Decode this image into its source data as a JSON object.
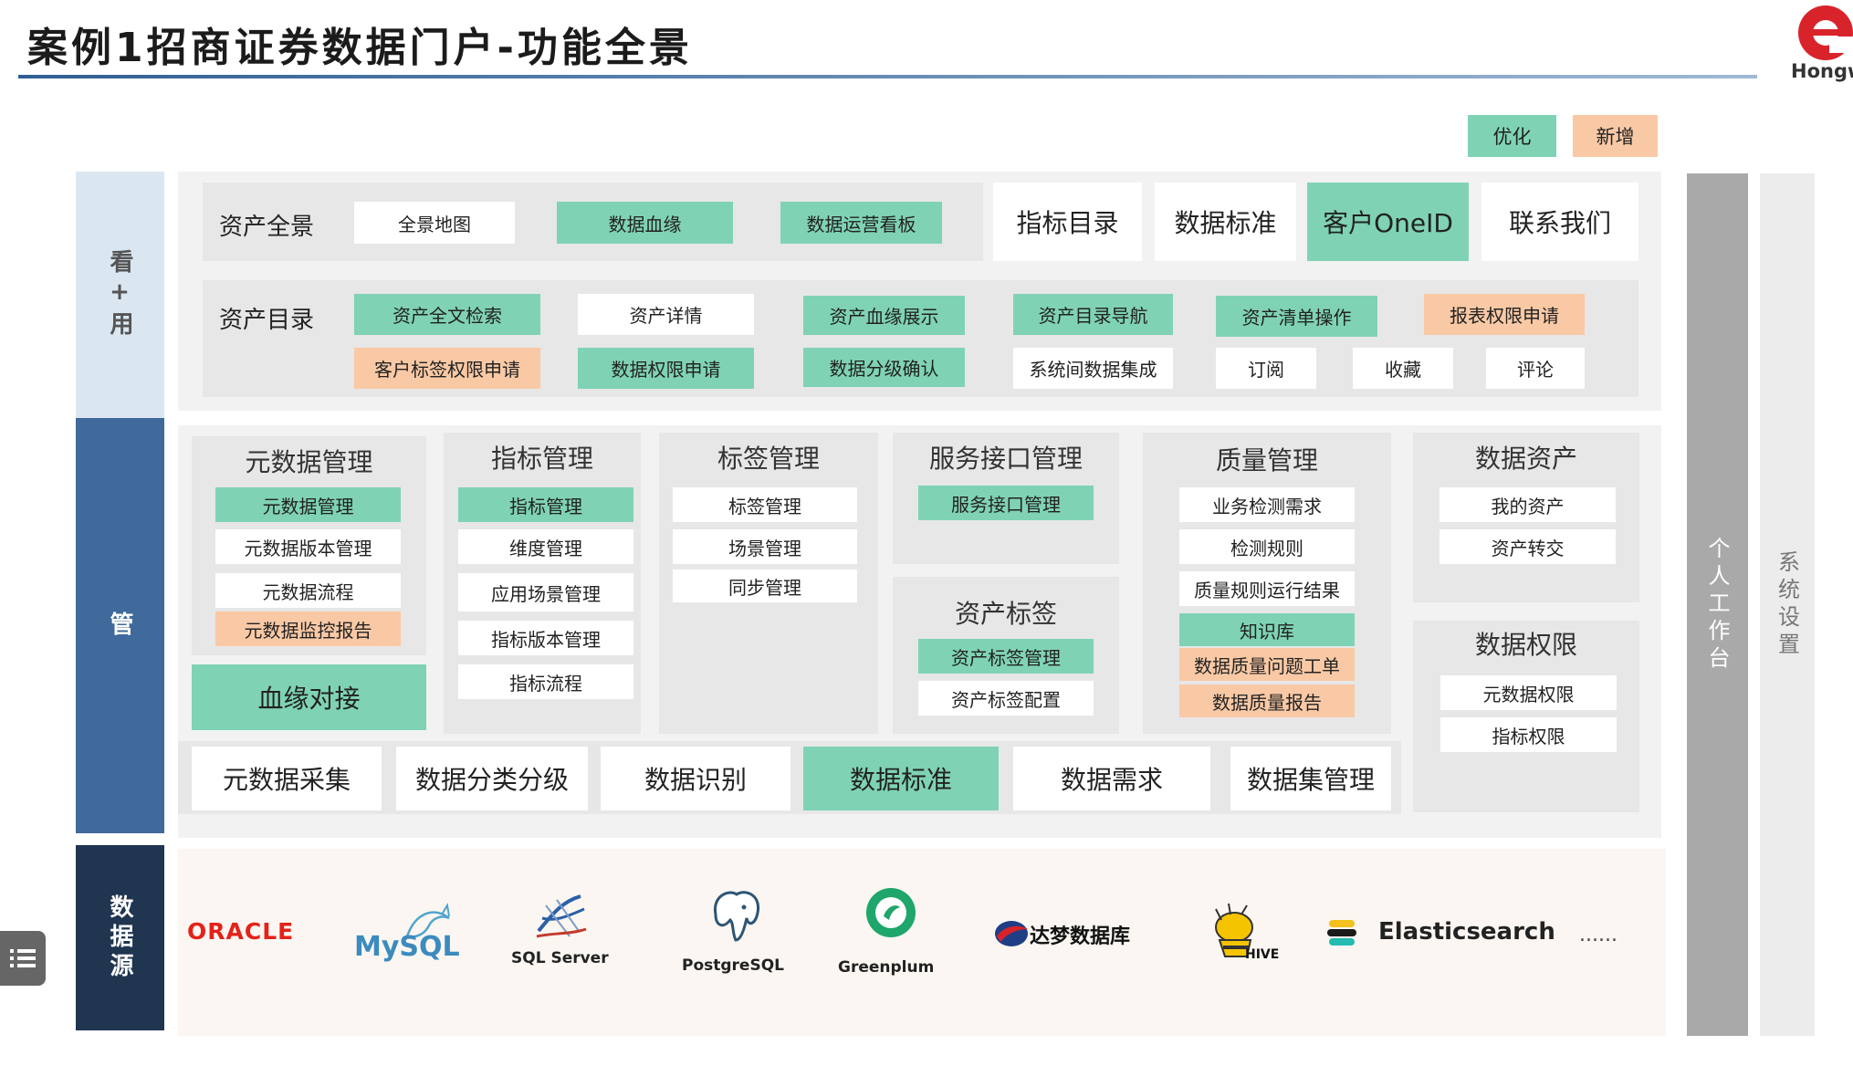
{
  "title": "案例1招商证券数据门户-功能全景",
  "brand": {
    "mark": "e",
    "text": "Hongw",
    "color": "#d9232a"
  },
  "legend": {
    "optimize": "优化",
    "add": "新增"
  },
  "colors": {
    "optimize": "#7fd3b4",
    "add": "#f9c9a5",
    "existing": "#ffffff"
  },
  "layers": {
    "view": "看+用",
    "manage": "管",
    "source": "数据源"
  },
  "right": {
    "workbench": "个人工作台",
    "settings": "系统设置"
  },
  "overview": {
    "label": "资产全景",
    "items": [
      "全景地图",
      "数据血缘",
      "数据运营看板"
    ],
    "tabs": [
      "指标目录",
      "数据标准",
      "客户OneID",
      "联系我们"
    ]
  },
  "catalog": {
    "label": "资产目录",
    "row1": [
      "资产全文检索",
      "资产详情",
      "资产血缘展示",
      "资产目录导航",
      "资产清单操作",
      "报表权限申请"
    ],
    "row2": [
      "客户标签权限申请",
      "数据权限申请",
      "数据分级确认",
      "系统间数据集成",
      "订阅",
      "收藏",
      "评论"
    ]
  },
  "groups": {
    "metadata": {
      "title": "元数据管理",
      "items": [
        "元数据管理",
        "元数据版本管理",
        "元数据流程",
        "元数据监控报告"
      ]
    },
    "lineage": "血缘对接",
    "indicator": {
      "title": "指标管理",
      "items": [
        "指标管理",
        "维度管理",
        "应用场景管理",
        "指标版本管理",
        "指标流程"
      ]
    },
    "tag": {
      "title": "标签管理",
      "items": [
        "标签管理",
        "场景管理",
        "同步管理"
      ]
    },
    "service": {
      "title": "服务接口管理",
      "items": [
        "服务接口管理"
      ]
    },
    "asset_tag": {
      "title": "资产标签",
      "items": [
        "资产标签管理",
        "资产标签配置"
      ]
    },
    "quality": {
      "title": "质量管理",
      "items": [
        "业务检测需求",
        "检测规则",
        "质量规则运行结果",
        "知识库",
        "数据质量问题工单",
        "数据质量报告"
      ]
    },
    "asset": {
      "title": "数据资产",
      "items": [
        "我的资产",
        "资产转交"
      ]
    },
    "permission": {
      "title": "数据权限",
      "items": [
        "元数据权限",
        "指标权限"
      ]
    }
  },
  "bottom_row": [
    "元数据采集",
    "数据分类分级",
    "数据识别",
    "数据标准",
    "数据需求",
    "数据集管理"
  ],
  "sources": [
    "ORACLE",
    "MySQL",
    "SQL Server",
    "PostgreSQL",
    "Greenplum",
    "达梦数据库",
    "HIVE",
    "Elasticsearch",
    "......"
  ]
}
